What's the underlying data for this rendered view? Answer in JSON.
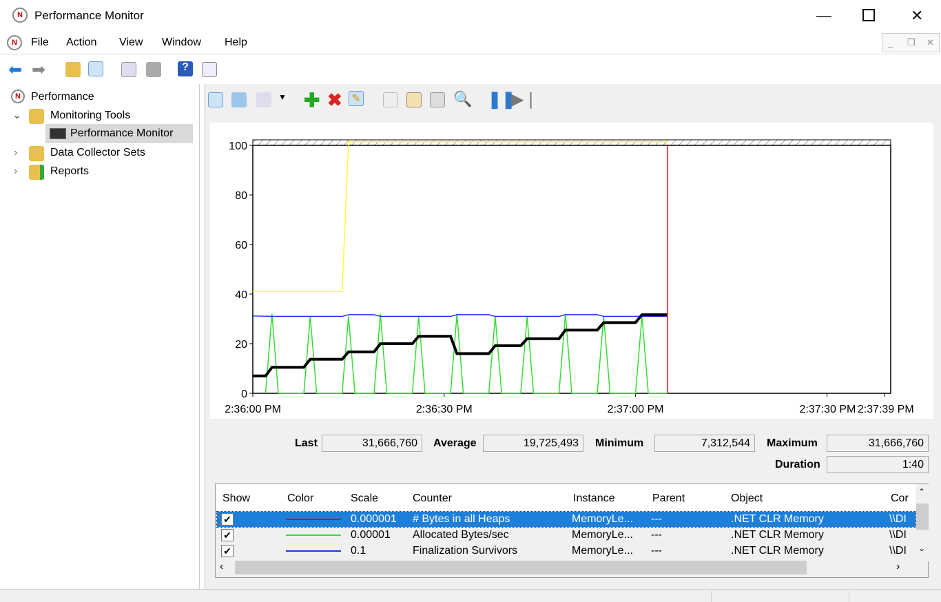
{
  "window": {
    "title": "Performance Monitor"
  },
  "menu": [
    "File",
    "Action",
    "View",
    "Window",
    "Help"
  ],
  "tree": {
    "root": "Performance",
    "monitoring_tools": "Monitoring Tools",
    "performance_monitor": "Performance Monitor",
    "data_collector_sets": "Data Collector Sets",
    "reports": "Reports"
  },
  "stats": {
    "last_label": "Last",
    "last": "31,666,760",
    "average_label": "Average",
    "average": "19,725,493",
    "minimum_label": "Minimum",
    "minimum": "7,312,544",
    "maximum_label": "Maximum",
    "maximum": "31,666,760",
    "duration_label": "Duration",
    "duration": "1:40"
  },
  "table": {
    "headers": [
      "Show",
      "Color",
      "Scale",
      "Counter",
      "Instance",
      "Parent",
      "Object",
      "Cor"
    ],
    "rows": [
      {
        "show": true,
        "color": "#c8102e",
        "scale": "0.000001",
        "counter": "# Bytes in all Heaps",
        "instance": "MemoryLe...",
        "parent": "---",
        "object": ".NET CLR Memory",
        "computer": "\\\\DI",
        "selected": true
      },
      {
        "show": true,
        "color": "#33dd33",
        "scale": "0.00001",
        "counter": "Allocated Bytes/sec",
        "instance": "MemoryLe...",
        "parent": "---",
        "object": ".NET CLR Memory",
        "computer": "\\\\DI",
        "selected": false
      },
      {
        "show": true,
        "color": "#2233ee",
        "scale": "0.1",
        "counter": "Finalization Survivors",
        "instance": "MemoryLe...",
        "parent": "---",
        "object": ".NET CLR Memory",
        "computer": "\\\\DI",
        "selected": false
      }
    ]
  },
  "chart_data": {
    "type": "line",
    "ylim": [
      0,
      100
    ],
    "yticks": [
      "0",
      "20",
      "40",
      "60",
      "80",
      "100"
    ],
    "xlim": [
      "2:36:00 PM",
      "2:37:39 PM"
    ],
    "xticks": [
      "2:36:00 PM",
      "2:36:30 PM",
      "2:37:00 PM",
      "2:37:30 PM",
      "2:37:39 PM"
    ],
    "current_time": "2:37:05 PM",
    "current_time_color": "#ff0000",
    "grid": false,
    "series": [
      {
        "color": "#000000",
        "width": 4,
        "points": [
          [
            "2:36:00",
            7
          ],
          [
            "2:36:02",
            7
          ],
          [
            "2:36:03",
            10.5
          ],
          [
            "2:36:08",
            10.5
          ],
          [
            "2:36:09",
            13.7
          ],
          [
            "2:36:14",
            13.7
          ],
          [
            "2:36:15",
            16.7
          ],
          [
            "2:36:19",
            16.7
          ],
          [
            "2:36:20",
            20
          ],
          [
            "2:36:25",
            20
          ],
          [
            "2:36:26",
            23
          ],
          [
            "2:36:31",
            23
          ],
          [
            "2:36:32",
            16
          ],
          [
            "2:36:37",
            16
          ],
          [
            "2:36:38",
            19.2
          ],
          [
            "2:36:42",
            19.2
          ],
          [
            "2:36:43",
            22
          ],
          [
            "2:36:48",
            22
          ],
          [
            "2:36:49",
            25.5
          ],
          [
            "2:36:54",
            25.5
          ],
          [
            "2:36:55",
            28.5
          ],
          [
            "2:37:00",
            28.5
          ],
          [
            "2:37:01",
            31.7
          ],
          [
            "2:37:05",
            31.7
          ]
        ]
      },
      {
        "color": "#ffff33",
        "width": 1.5,
        "points": [
          [
            "2:36:00",
            41
          ],
          [
            "2:36:14",
            41
          ],
          [
            "2:36:15",
            101.5
          ],
          [
            "2:37:05",
            101.5
          ]
        ]
      },
      {
        "color": "#2233ee",
        "width": 1.5,
        "points": [
          [
            "2:36:00",
            31.2
          ],
          [
            "2:36:03",
            31
          ],
          [
            "2:36:14",
            31
          ],
          [
            "2:36:15",
            31.7
          ],
          [
            "2:36:19",
            31.7
          ],
          [
            "2:36:20",
            31
          ],
          [
            "2:36:31",
            31
          ],
          [
            "2:36:32",
            31.7
          ],
          [
            "2:36:37",
            31.7
          ],
          [
            "2:36:38",
            31
          ],
          [
            "2:36:48",
            31
          ],
          [
            "2:36:49",
            31.7
          ],
          [
            "2:36:54",
            31.7
          ],
          [
            "2:36:55",
            31
          ],
          [
            "2:37:05",
            31
          ]
        ]
      },
      {
        "color": "#33dd33",
        "width": 1.5,
        "points": [
          [
            "2:36:02",
            0
          ],
          [
            "2:36:03",
            32
          ],
          [
            "2:36:04",
            0
          ],
          [
            "2:36:08",
            0
          ],
          [
            "2:36:09",
            31
          ],
          [
            "2:36:10",
            0
          ],
          [
            "2:36:14",
            0
          ],
          [
            "2:36:15",
            31
          ],
          [
            "2:36:16",
            0
          ],
          [
            "2:36:19",
            0
          ],
          [
            "2:36:20",
            32
          ],
          [
            "2:36:21",
            0
          ],
          [
            "2:36:25",
            0
          ],
          [
            "2:36:26",
            31
          ],
          [
            "2:36:27",
            0
          ],
          [
            "2:36:31",
            0
          ],
          [
            "2:36:32",
            32
          ],
          [
            "2:36:33",
            0
          ],
          [
            "2:36:37",
            0
          ],
          [
            "2:36:38",
            31
          ],
          [
            "2:36:39",
            0
          ],
          [
            "2:36:42",
            0
          ],
          [
            "2:36:43",
            31
          ],
          [
            "2:36:44",
            0
          ],
          [
            "2:36:48",
            0
          ],
          [
            "2:36:49",
            32
          ],
          [
            "2:36:50",
            0
          ],
          [
            "2:36:54",
            0
          ],
          [
            "2:36:55",
            31
          ],
          [
            "2:36:56",
            0
          ],
          [
            "2:37:00",
            0
          ],
          [
            "2:37:01",
            31
          ],
          [
            "2:37:02",
            0
          ],
          [
            "2:37:05",
            0
          ]
        ]
      }
    ]
  }
}
